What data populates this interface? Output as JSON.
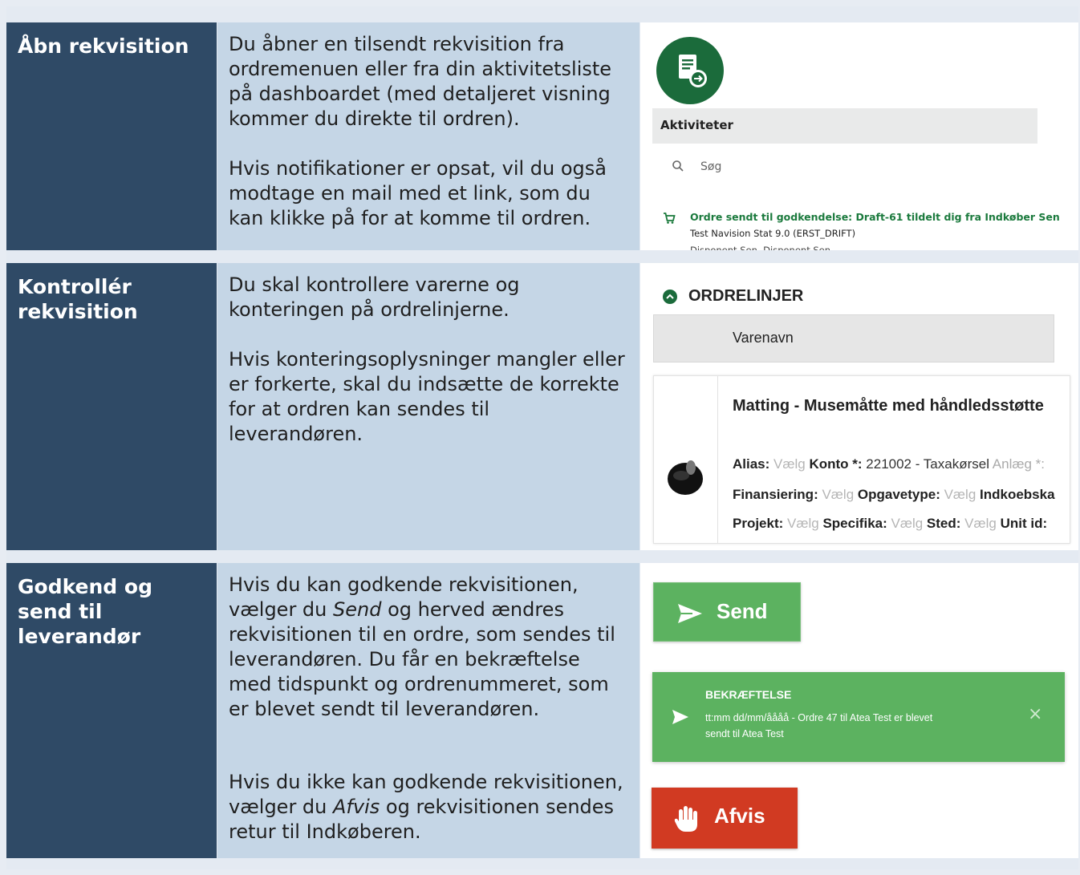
{
  "rows": [
    {
      "heading": "Åbn rekvisition",
      "para1": "Du åbner en tilsendt rekvisition fra ordremenuen eller fra din aktivitetsliste på dashboardet (med detaljeret visning kommer du direkte til ordren).",
      "para2": "Hvis notifikationer er opsat, vil du også modtage en mail med et link, som du kan klikke på for at komme til ordren."
    },
    {
      "heading": "Kontrollér rekvisition",
      "para1": "Du skal kontrollere varerne og konteringen på ordrelinjerne.",
      "para2": "Hvis konteringsoplysninger mangler eller er forkerte, skal du indsætte de korrekte for at ordren kan sendes til leverandøren."
    },
    {
      "heading": "Godkend og send til leverandør",
      "para1_a": "Hvis du kan godkende rekvisitionen, vælger du ",
      "para1_em": "Send",
      "para1_b": " og herved ændres rekvisitionen til en ordre, som sendes til leverandøren. Du får en bekræftelse med tidspunkt og ordrenummeret, som er blevet sendt til leverandøren.",
      "para2_a": "Hvis du ikke kan godkende rekvisitionen, vælger du ",
      "para2_em": "Afvis",
      "para2_b": " og rekvisitionen sendes retur til Indkøberen."
    }
  ],
  "activities": {
    "header": "Aktiviteter",
    "search_placeholder": "Søg",
    "item_title": "Ordre sendt til godkendelse: Draft-61 tildelt dig fra Indkøber Sen",
    "item_line2": "Test Navision Stat 9.0 (ERST_DRIFT)",
    "item_line3": "Disponent Sen, Disponent Sen"
  },
  "orderlines": {
    "section_title": "ORDRELINJER",
    "column_header": "Varenavn",
    "product_name": "Matting - Musemåtte med håndledsstøtte",
    "line1": [
      {
        "label": "Alias:",
        "value": "Vælg",
        "muted": true
      },
      {
        "label": "Konto *:",
        "value": "221002 - Taxakørsel",
        "muted": false
      },
      {
        "label": "Anlæg *:",
        "value": "",
        "muted": true
      }
    ],
    "line2": [
      {
        "label": "Finansiering:",
        "value": "Vælg",
        "muted": true
      },
      {
        "label": "Opgavetype:",
        "value": "Vælg",
        "muted": true
      },
      {
        "label": "Indkoebska",
        "value": "",
        "muted": false
      }
    ],
    "line3": [
      {
        "label": "Projekt:",
        "value": "Vælg",
        "muted": true
      },
      {
        "label": "Specifika:",
        "value": "Vælg",
        "muted": true
      },
      {
        "label": "Sted:",
        "value": "Vælg",
        "muted": true
      },
      {
        "label": "Unit id:",
        "value": "",
        "muted": false
      }
    ]
  },
  "actions": {
    "send_label": "Send",
    "toast_title": "BEKRÆFTELSE",
    "toast_text_1": "tt:mm dd/mm/åååå - Ordre 47 til Atea Test er blevet",
    "toast_text_2": "sendt til Atea Test",
    "toast_close": "×",
    "afvis_label": "Afvis"
  },
  "colors": {
    "header_dark": "#2f4a66",
    "body_light": "#c5d6e6",
    "green": "#5cb260",
    "red": "#d13a22",
    "dark_green": "#1b6b3b"
  }
}
